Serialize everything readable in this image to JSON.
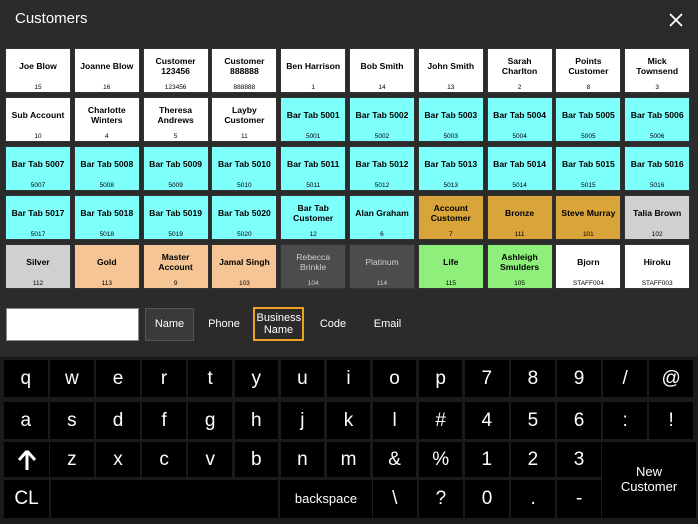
{
  "window": {
    "title": "Customers",
    "close_icon": "close-icon"
  },
  "customers": [
    {
      "name": "Joe Blow",
      "code": "15",
      "color": "white"
    },
    {
      "name": "Joanne Blow",
      "code": "16",
      "color": "white"
    },
    {
      "name": "Customer 123456",
      "code": "123456",
      "color": "white"
    },
    {
      "name": "Customer 888888",
      "code": "888888",
      "color": "white"
    },
    {
      "name": "Ben Harrison",
      "code": "1",
      "color": "white"
    },
    {
      "name": "Bob Smith",
      "code": "14",
      "color": "white"
    },
    {
      "name": "John Smith",
      "code": "13",
      "color": "white"
    },
    {
      "name": "Sarah Charlton",
      "code": "2",
      "color": "white"
    },
    {
      "name": "Points Customer",
      "code": "8",
      "color": "white"
    },
    {
      "name": "Mick Townsend",
      "code": "3",
      "color": "white"
    },
    {
      "name": "Sub Account",
      "code": "10",
      "color": "white"
    },
    {
      "name": "Charlotte Winters",
      "code": "4",
      "color": "white"
    },
    {
      "name": "Theresa Andrews",
      "code": "5",
      "color": "white"
    },
    {
      "name": "Layby Customer",
      "code": "11",
      "color": "white"
    },
    {
      "name": "Bar Tab 5001",
      "code": "5001",
      "color": "cyan"
    },
    {
      "name": "Bar Tab 5002",
      "code": "5002",
      "color": "cyan"
    },
    {
      "name": "Bar Tab 5003",
      "code": "5003",
      "color": "cyan"
    },
    {
      "name": "Bar Tab 5004",
      "code": "5004",
      "color": "cyan"
    },
    {
      "name": "Bar Tab 5005",
      "code": "5005",
      "color": "cyan"
    },
    {
      "name": "Bar Tab 5006",
      "code": "5006",
      "color": "cyan"
    },
    {
      "name": "Bar Tab 5007",
      "code": "5007",
      "color": "cyan"
    },
    {
      "name": "Bar Tab 5008",
      "code": "5008",
      "color": "cyan"
    },
    {
      "name": "Bar Tab 5009",
      "code": "5009",
      "color": "cyan"
    },
    {
      "name": "Bar Tab 5010",
      "code": "5010",
      "color": "cyan"
    },
    {
      "name": "Bar Tab 5011",
      "code": "5011",
      "color": "cyan"
    },
    {
      "name": "Bar Tab 5012",
      "code": "5012",
      "color": "cyan"
    },
    {
      "name": "Bar Tab 5013",
      "code": "5013",
      "color": "cyan"
    },
    {
      "name": "Bar Tab 5014",
      "code": "5014",
      "color": "cyan"
    },
    {
      "name": "Bar Tab 5015",
      "code": "5015",
      "color": "cyan"
    },
    {
      "name": "Bar Tab 5016",
      "code": "5016",
      "color": "cyan"
    },
    {
      "name": "Bar Tab 5017",
      "code": "5017",
      "color": "cyan"
    },
    {
      "name": "Bar Tab 5018",
      "code": "5018",
      "color": "cyan"
    },
    {
      "name": "Bar Tab 5019",
      "code": "5019",
      "color": "cyan"
    },
    {
      "name": "Bar Tab 5020",
      "code": "5020",
      "color": "cyan"
    },
    {
      "name": "Bar Tab Customer",
      "code": "12",
      "color": "cyan"
    },
    {
      "name": "Alan Graham",
      "code": "6",
      "color": "cyan"
    },
    {
      "name": "Account Customer",
      "code": "7",
      "color": "orange"
    },
    {
      "name": "Bronze",
      "code": "111",
      "color": "orange"
    },
    {
      "name": "Steve Murray",
      "code": "101",
      "color": "orange"
    },
    {
      "name": "Talia Brown",
      "code": "102",
      "color": "gray"
    },
    {
      "name": "Silver",
      "code": "112",
      "color": "gray"
    },
    {
      "name": "Gold",
      "code": "113",
      "color": "peach"
    },
    {
      "name": "Master Account",
      "code": "9",
      "color": "peach"
    },
    {
      "name": "Jamal Singh",
      "code": "103",
      "color": "peach"
    },
    {
      "name": "Rebecca Brinkle",
      "code": "104",
      "color": "dark"
    },
    {
      "name": "Platinum",
      "code": "114",
      "color": "dark"
    },
    {
      "name": "Life",
      "code": "115",
      "color": "green"
    },
    {
      "name": "Ashleigh Smulders",
      "code": "105",
      "color": "green"
    },
    {
      "name": "Bjorn",
      "code": "STAFF004",
      "color": "white"
    },
    {
      "name": "Hiroku",
      "code": "STAFF003",
      "color": "white"
    }
  ],
  "search": {
    "value": "",
    "placeholder": ""
  },
  "filters": {
    "name": "Name",
    "phone": "Phone",
    "business_name": "Business Name",
    "code": "Code",
    "email": "Email",
    "active": "business_name"
  },
  "keyboard": {
    "row1": [
      "q",
      "w",
      "e",
      "r",
      "t",
      "y",
      "u",
      "i",
      "o",
      "p",
      "7",
      "8",
      "9",
      "/",
      "@"
    ],
    "row2": [
      "a",
      "s",
      "d",
      "f",
      "g",
      "h",
      "j",
      "k",
      "l",
      "#",
      "4",
      "5",
      "6",
      ":",
      "!"
    ],
    "row3": [
      "z",
      "x",
      "c",
      "v",
      "b",
      "n",
      "m",
      "&",
      "%",
      "1",
      "2",
      "3"
    ],
    "shift_icon": "shift-arrow-icon",
    "cl": "CL",
    "backspace": "backspace",
    "row4": [
      "\\",
      "?",
      "0",
      ".",
      "-"
    ],
    "new_customer": "New Customer"
  },
  "colors": {
    "white": "#ffffff",
    "cyan": "#7dfffc",
    "orange": "#d9a43a",
    "peach": "#f5c595",
    "gray": "#d0d0d0",
    "dark": "#4c4c4c",
    "green": "#8ef07a",
    "active_border": "#f0a020"
  }
}
